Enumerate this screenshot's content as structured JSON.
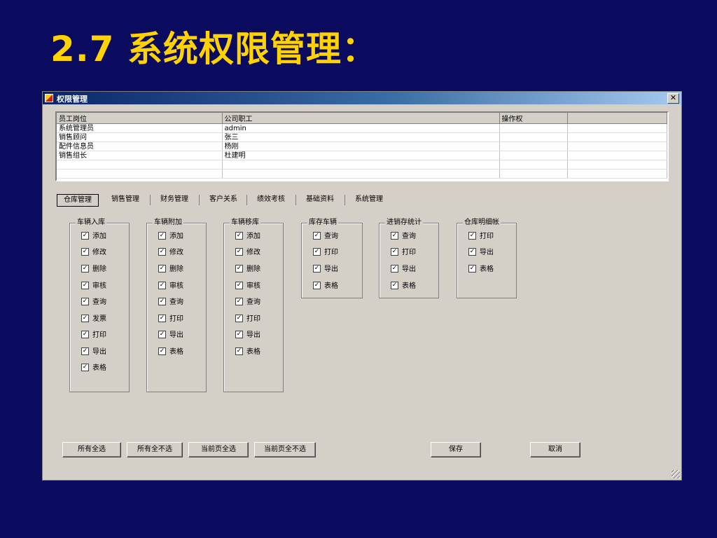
{
  "slide_title": "2.7 系统权限管理：",
  "window": {
    "title": "权限管理",
    "close_label": "✕"
  },
  "grid": {
    "columns": [
      "员工岗位",
      "公司职工",
      "操作权",
      ""
    ],
    "rows": [
      [
        "系统管理员",
        "admin",
        "",
        ""
      ],
      [
        "销售顾问",
        "张三",
        "",
        ""
      ],
      [
        "配件信息员",
        "杨刚",
        "",
        ""
      ],
      [
        "销售组长",
        "杜建明",
        "",
        ""
      ],
      [
        "",
        "",
        "",
        ""
      ],
      [
        "",
        "",
        "",
        ""
      ]
    ]
  },
  "tabs": [
    "仓库管理",
    "销售管理",
    "财务管理",
    "客户关系",
    "绩效考核",
    "基础资料",
    "系统管理"
  ],
  "active_tab": 0,
  "groups": [
    {
      "title": "车辆入库",
      "items": [
        "添加",
        "修改",
        "删除",
        "审核",
        "查询",
        "发票",
        "打印",
        "导出",
        "表格"
      ]
    },
    {
      "title": "车辆附加",
      "items": [
        "添加",
        "修改",
        "删除",
        "审核",
        "查询",
        "打印",
        "导出",
        "表格"
      ]
    },
    {
      "title": "车辆移库",
      "items": [
        "添加",
        "修改",
        "删除",
        "审核",
        "查询",
        "打印",
        "导出",
        "表格"
      ]
    },
    {
      "title": "库存车辆",
      "items": [
        "查询",
        "打印",
        "导出",
        "表格"
      ]
    },
    {
      "title": "进销存统计",
      "items": [
        "查询",
        "打印",
        "导出",
        "表格"
      ]
    },
    {
      "title": "仓库明细帐",
      "items": [
        "打印",
        "导出",
        "表格"
      ]
    }
  ],
  "check_mark": "✓",
  "buttons": {
    "select_all": "所有全选",
    "deselect_all": "所有全不选",
    "page_select_all": "当前页全选",
    "page_deselect_all": "当前页全不选",
    "save": "保存",
    "cancel": "取消"
  }
}
